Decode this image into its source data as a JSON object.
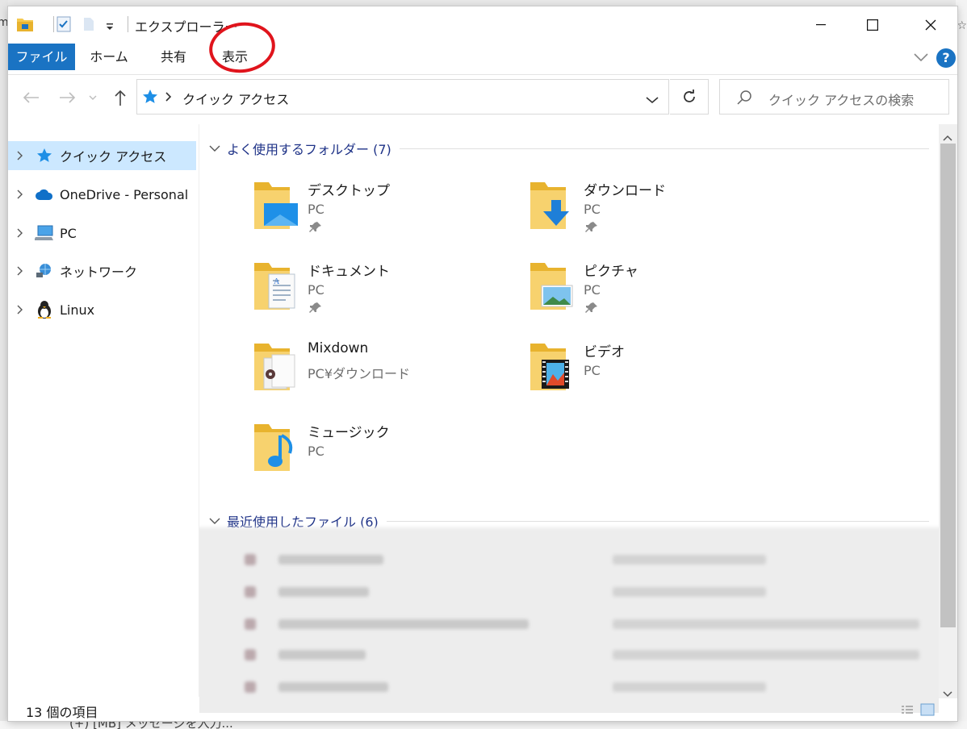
{
  "window": {
    "title": "エクスプローラー"
  },
  "ribbon": {
    "tabs": [
      "ファイル",
      "ホーム",
      "共有",
      "表示"
    ]
  },
  "address": {
    "path": "クイック アクセス",
    "search_placeholder": "クイック アクセスの検索"
  },
  "nav": {
    "items": [
      {
        "label": "クイック アクセス",
        "icon": "star-icon",
        "selected": true
      },
      {
        "label": "OneDrive - Personal",
        "icon": "cloud-icon"
      },
      {
        "label": "PC",
        "icon": "computer-icon"
      },
      {
        "label": "ネットワーク",
        "icon": "network-icon"
      },
      {
        "label": "Linux",
        "icon": "penguin-icon"
      }
    ]
  },
  "frequent": {
    "header": "よく使用するフォルダー (7)",
    "folders": [
      {
        "name": "デスクトップ",
        "location": "PC",
        "pinned": true,
        "icon": "desktop-folder-icon"
      },
      {
        "name": "ダウンロード",
        "location": "PC",
        "pinned": true,
        "icon": "downloads-folder-icon"
      },
      {
        "name": "ドキュメント",
        "location": "PC",
        "pinned": true,
        "icon": "documents-folder-icon"
      },
      {
        "name": "ピクチャ",
        "location": "PC",
        "pinned": true,
        "icon": "pictures-folder-icon"
      },
      {
        "name": "Mixdown",
        "location": "PC¥ダウンロード",
        "pinned": false,
        "icon": "mixdown-folder-icon"
      },
      {
        "name": "ビデオ",
        "location": "PC",
        "pinned": false,
        "icon": "videos-folder-icon"
      },
      {
        "name": "ミュージック",
        "location": "PC",
        "pinned": false,
        "icon": "music-folder-icon"
      }
    ]
  },
  "recent": {
    "header": "最近使用したファイル (6)"
  },
  "status": {
    "count": "13 個の項目"
  },
  "background": {
    "right_edge": "☆",
    "bottom_text": "(+) [MB]   メッセージを入力..."
  },
  "colors": {
    "accent": "#1a73c3",
    "selection": "#cce8ff",
    "group_header": "#1e3287",
    "annotation": "#e0141c",
    "folder": "#f5c94f"
  }
}
